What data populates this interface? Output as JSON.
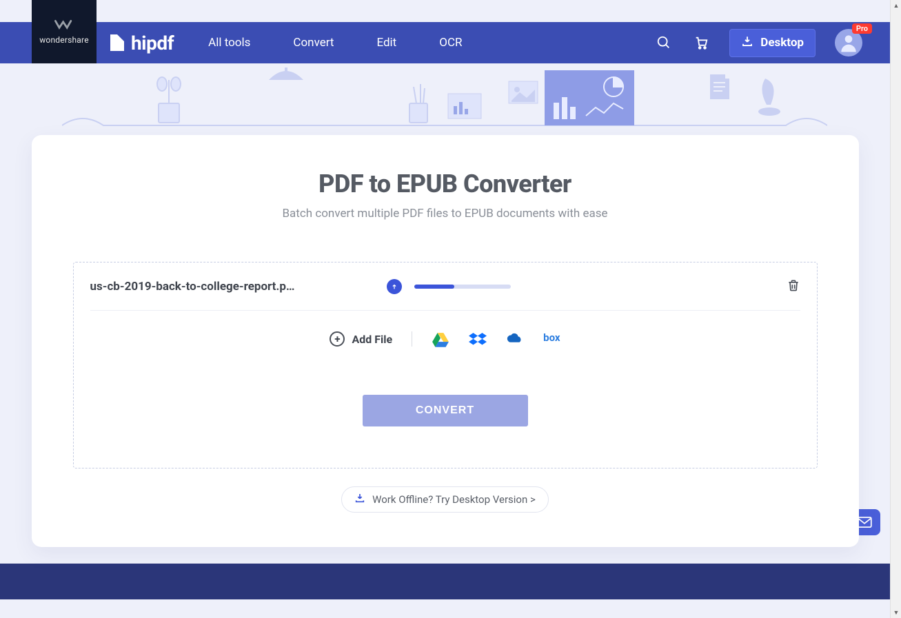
{
  "brand": {
    "parent": "wondershare",
    "product": "hipdf"
  },
  "nav": {
    "all_tools": "All tools",
    "convert": "Convert",
    "edit": "Edit",
    "ocr": "OCR"
  },
  "header": {
    "desktop_label": "Desktop",
    "pro_badge": "Pro"
  },
  "page": {
    "title": "PDF to EPUB Converter",
    "subtitle": "Batch convert multiple PDF files to EPUB documents with ease"
  },
  "file": {
    "name": "us-cb-2019-back-to-college-report.p…",
    "progress_percent": 42
  },
  "actions": {
    "add_file": "Add File",
    "convert": "CONVERT",
    "offline": "Work Offline? Try Desktop Version >"
  },
  "cloud_sources": {
    "gdrive": "google-drive-icon",
    "dropbox": "dropbox-icon",
    "onedrive": "onedrive-icon",
    "box": "box-icon"
  }
}
